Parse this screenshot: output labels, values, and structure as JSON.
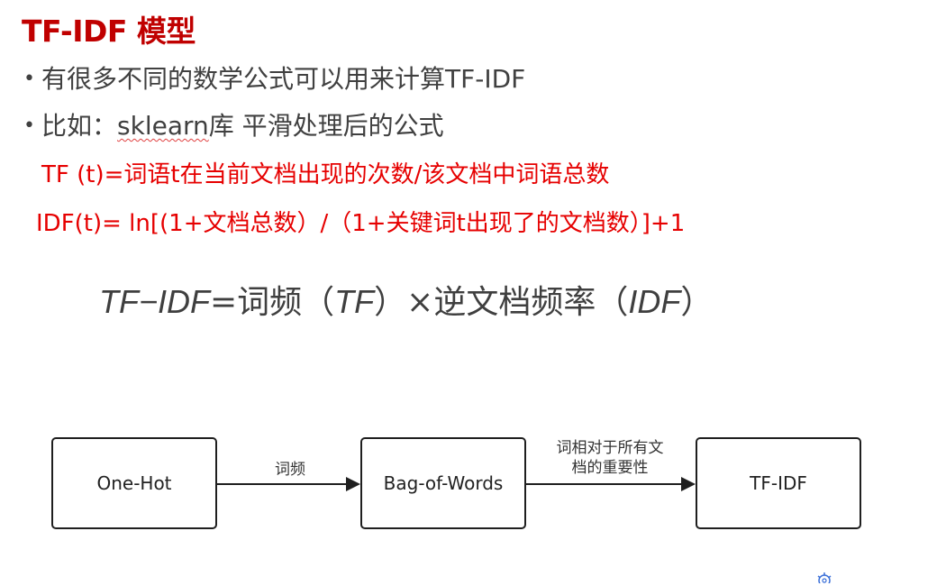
{
  "slide": {
    "title": "TF-IDF 模型",
    "bullets": [
      {
        "pre": "有很多不同的数学公式可以用来计算TF-IDF",
        "underlined": "",
        "post": ""
      },
      {
        "pre": "比如：",
        "underlined": "sklearn",
        "post": "库 平滑处理后的公式"
      }
    ],
    "red_lines": [
      "TF (t)=词语t在当前文档出现的次数/该文档中词语总数",
      "IDF(t)= ln[(1+文档总数）/（1+关键词t出现了的文档数）]+1"
    ],
    "formula": {
      "lhs": "TF−IDF",
      "eq": "=词频（",
      "tf": "TF",
      "mid": "）×逆文档频率（",
      "idf": "IDF",
      "end": "）"
    },
    "bullet_glyph": "•"
  },
  "diagram": {
    "nodes": [
      "One-Hot",
      "Bag-of-Words",
      "TF-IDF"
    ],
    "edges": [
      {
        "label_lines": [
          "词频"
        ]
      },
      {
        "label_lines": [
          "词相对于所有文",
          "档的重要性"
        ]
      }
    ]
  },
  "colors": {
    "title": "#c00000",
    "red_text": "#e60000",
    "body_text": "#404040"
  },
  "icons": {
    "corner": "gear-icon"
  }
}
